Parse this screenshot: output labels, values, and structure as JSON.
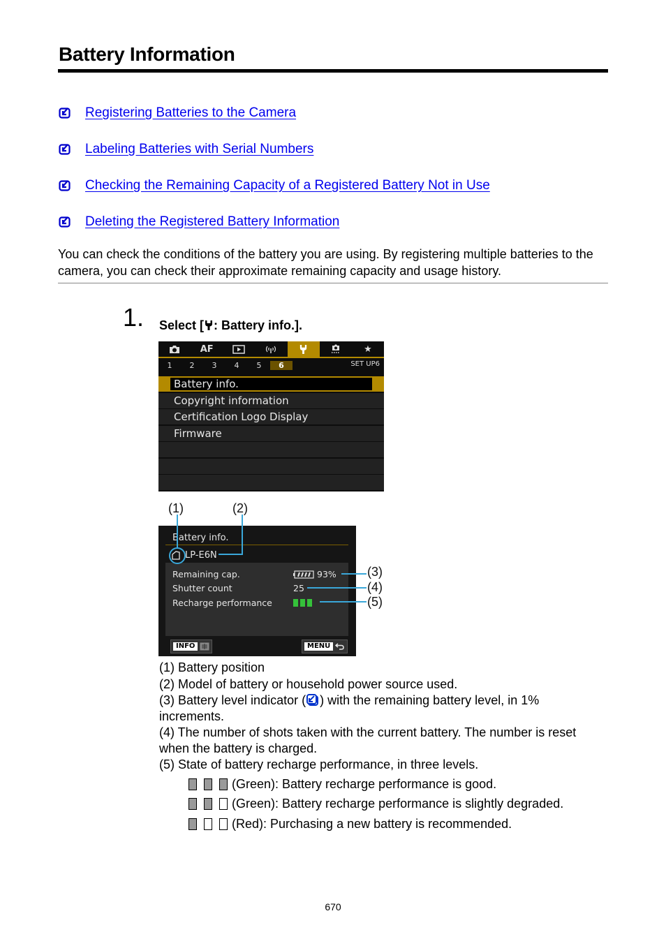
{
  "page": {
    "title": "Battery Information",
    "page_number": "670"
  },
  "toc": {
    "items": [
      {
        "label": "Registering Batteries to the Camera",
        "icon": "checkbox-arrow-icon"
      },
      {
        "label": "Labeling Batteries with Serial Numbers",
        "icon": "checkbox-arrow-icon"
      },
      {
        "label": "Checking the Remaining Capacity of a Registered Battery Not in Use",
        "icon": "checkbox-arrow-icon"
      },
      {
        "label": "Deleting the Registered Battery Information",
        "icon": "checkbox-arrow-icon"
      }
    ]
  },
  "intro": "You can check the conditions of the battery you are using. By registering multiple batteries to the camera, you can check their approximate remaining capacity and usage history.",
  "step": {
    "number": "1.",
    "text_prefix": "Select [",
    "text_suffix": ": Battery info.]."
  },
  "camera_menu": {
    "tabs": [
      "camera",
      "AF",
      "playback",
      "wireless",
      "setup",
      "custom",
      "my-menu"
    ],
    "tab_labels": {
      "af": "AF"
    },
    "active_tab": "setup",
    "page_numbers": [
      "1",
      "2",
      "3",
      "4",
      "5",
      "6"
    ],
    "active_page": "6",
    "page_label": "SET UP6",
    "items": [
      "Battery info.",
      "Copyright information",
      "Certification Logo Display",
      "Firmware",
      "",
      "",
      ""
    ],
    "selected_index": 0,
    "accent_color": "#b38a00"
  },
  "battery_screen": {
    "callouts": [
      "(1)",
      "(2)",
      "(3)",
      "(4)",
      "(5)"
    ],
    "title": "Battery info.",
    "model": "LP-E6N",
    "rows": [
      {
        "label": "Remaining cap.",
        "value": "93%"
      },
      {
        "label": "Shutter count",
        "value": "25"
      },
      {
        "label": "Recharge performance",
        "value": ""
      }
    ],
    "recharge_level": 3,
    "recharge_level_max": 3,
    "recharge_color": "#35c23a",
    "info_key": "INFO",
    "menu_key": "MENU"
  },
  "legend": {
    "lines": [
      "(1) Battery position",
      "(2) Model of battery or household power source used.",
      "(3) Battery level indicator (",
      ") with the remaining battery level, in 1%",
      "increments.",
      "(4) The number of shots taken with the current battery. The number is reset",
      "when the battery is charged.",
      "(5) State of battery recharge performance, in three levels."
    ],
    "levels": [
      {
        "filled": 3,
        "text": "(Green): Battery recharge performance is good."
      },
      {
        "filled": 2,
        "text": "(Green): Battery recharge performance is slightly degraded."
      },
      {
        "filled": 1,
        "text": "(Red): Purchasing a new battery is recommended."
      }
    ]
  }
}
